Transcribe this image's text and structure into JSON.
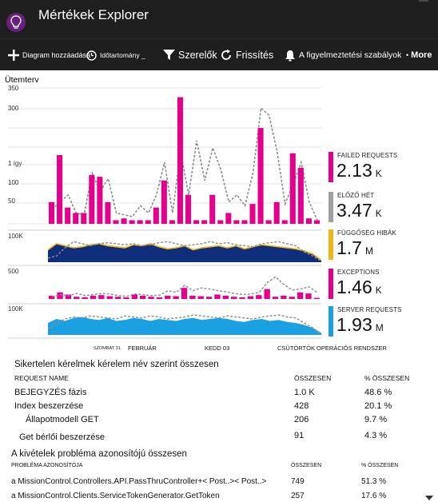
{
  "header": {
    "title": "Mértékek Explorer"
  },
  "toolbar": {
    "add_chart": "Diagram hozzáadása",
    "time_range": "Időtartomány _",
    "filters": "Szerelők",
    "refresh": "Frissítés",
    "alert_rules": "A figyelmeztetési szabályok",
    "more": "More"
  },
  "chart": {
    "title": "Ütemterv",
    "top_ticks": [
      "350",
      "300",
      "1 így",
      "100",
      "50"
    ],
    "dep_tick": "100K",
    "exc_tick": "500",
    "srv_tick": "100K",
    "x_labels": [
      "SZOMBAT 31.",
      "FEBRUÁR",
      "KEDD 03",
      "CSÜTÖRTÖK OPERÁCIÓS RENDSZER"
    ]
  },
  "legend": [
    {
      "name": "FAILED REQUESTS",
      "value": "2.13",
      "unit": "K",
      "color": "#e3008c"
    },
    {
      "name": "ELŐZŐ HÉT",
      "value": "3.47",
      "unit": "K",
      "color": "#a0a0a0"
    },
    {
      "name": "FÜGGŐSÉG HIBÁK",
      "value": "1.7",
      "unit": "M",
      "color": "#f2b517"
    },
    {
      "name": "EXCEPTIONS",
      "value": "1.46",
      "unit": "K",
      "color": "#e3008c"
    },
    {
      "name": "SERVER REQUESTS",
      "value": "1.93",
      "unit": "M",
      "color": "#1ba1e2"
    }
  ],
  "colors": {
    "failed": "#e3008c",
    "previous": "#8c8c8c",
    "dependency_fill": "#0e2d7a",
    "dependency_line": "#f2b517",
    "server": "#1ba1e2",
    "app_icon": "#68217a"
  },
  "chart_data": [
    {
      "type": "bar",
      "title": "",
      "series": [
        {
          "name": "FAILED REQUESTS",
          "values": [
            60,
            190,
            45,
            30,
            30,
            135,
            130,
            60,
            10,
            15,
            10,
            10,
            10,
            45,
            120,
            10,
            350,
            80,
            10,
            10,
            80,
            10,
            30,
            10,
            10,
            55,
            265,
            10,
            60,
            10,
            195,
            155,
            15,
            10
          ]
        },
        {
          "name": "ELŐZŐ HÉT",
          "values": [
            40,
            60,
            80,
            30,
            25,
            140,
            90,
            125,
            30,
            25,
            20,
            50,
            30,
            80,
            170,
            30,
            200,
            80,
            230,
            120,
            210,
            150,
            60,
            80,
            50,
            140,
            320,
            300,
            200,
            55,
            110,
            170,
            60,
            10
          ]
        }
      ],
      "ylim": [
        0,
        380
      ]
    },
    {
      "type": "area",
      "title": "",
      "series": [
        {
          "name": "FÜGGŐSÉG HIBÁK",
          "values": [
            60,
            90,
            80,
            70,
            75,
            85,
            90,
            80,
            75,
            70,
            85,
            80,
            90,
            75,
            65,
            70,
            80,
            60,
            70,
            75,
            80,
            70,
            80,
            65,
            75,
            85,
            80,
            75,
            70,
            65,
            55,
            40,
            10
          ]
        },
        {
          "name": "ELŐZŐ HÉT",
          "values": [
            20,
            30,
            70,
            100,
            90,
            80,
            90,
            95,
            90,
            85,
            90,
            80,
            85,
            95,
            100,
            90,
            80,
            85,
            90,
            100,
            90,
            95,
            85,
            80,
            75,
            90,
            95,
            100,
            90,
            80,
            50,
            30,
            5
          ]
        }
      ],
      "ylim": [
        0,
        140
      ]
    },
    {
      "type": "bar",
      "title": "",
      "series": [
        {
          "name": "EXCEPTIONS",
          "values": [
            60,
            120,
            80,
            40,
            30,
            60,
            70,
            50,
            40,
            30,
            80,
            60,
            40,
            30,
            60,
            50,
            200,
            60,
            50,
            40,
            80,
            60,
            40,
            30,
            50,
            70,
            180,
            40,
            60,
            40,
            120,
            100,
            20
          ]
        },
        {
          "name": "ELŐZŐ HÉT",
          "values": [
            40,
            80,
            60,
            100,
            60,
            80,
            100,
            90,
            60,
            50,
            90,
            80,
            60,
            70,
            150,
            120,
            250,
            150,
            200,
            180,
            150,
            130,
            100,
            80,
            90,
            120,
            300,
            400,
            260,
            160,
            180,
            220,
            120
          ]
        }
      ],
      "ylim": [
        0,
        550
      ]
    },
    {
      "type": "area",
      "title": "",
      "series": [
        {
          "name": "SERVER REQUESTS",
          "values": [
            60,
            80,
            70,
            85,
            90,
            80,
            75,
            85,
            70,
            75,
            85,
            80,
            70,
            80,
            75,
            70,
            80,
            85,
            75,
            80,
            85,
            80,
            70,
            65,
            75,
            80,
            70,
            75,
            65,
            60,
            50,
            35,
            10
          ]
        },
        {
          "name": "ELŐZŐ HÉT",
          "values": [
            30,
            60,
            80,
            90,
            85,
            95,
            90,
            85,
            80,
            95,
            90,
            85,
            95,
            90,
            80,
            85,
            90,
            100,
            95,
            90,
            85,
            95,
            90,
            85,
            80,
            90,
            95,
            100,
            90,
            85,
            60,
            35,
            5
          ]
        }
      ],
      "ylim": [
        0,
        140
      ]
    }
  ],
  "table1": {
    "title": "Sikertelen kérelmek kérelem név szerint összesen",
    "columns": [
      "REQUEST NAME",
      "ÖSSZESEN",
      "% ÖSSZESEN"
    ],
    "rows": [
      {
        "name": "BEJEGYZÉS fázis",
        "total": "1.0 K",
        "pct": "48.6 %"
      },
      {
        "name": "Index beszerzése",
        "total": "428",
        "pct": "20.1 %"
      },
      {
        "name": "Állapotmodell GET",
        "total": "206",
        "pct": "9.7 %"
      },
      {
        "name": "Get bérlői beszerzése",
        "total": "91",
        "pct": "4.3 %"
      }
    ]
  },
  "table2": {
    "title": "A kivételek probléma azonosítójú összesen",
    "columns": [
      "PROBLÉMA AZONOSÍTÓJA",
      "ÖSSZESEN",
      "% ÖSSZESEN"
    ],
    "rows": [
      {
        "name": "a MissionControl.Controllers.API.PassThruController+< Post..>< Post..>",
        "total": "749",
        "pct": "51.3 %"
      },
      {
        "name": "a MissionControl.Clients.ServiceTokenGenerator.GetToken",
        "total": "257",
        "pct": "17.6 %"
      }
    ]
  }
}
